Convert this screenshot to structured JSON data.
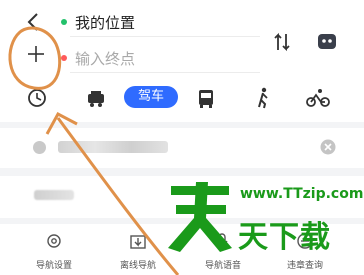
{
  "route": {
    "origin_label": "我的位置",
    "destination_placeholder": "输入终点"
  },
  "colors": {
    "start_dot": "#23c16b",
    "end_dot": "#ff5a5a",
    "accent": "#2f6bff",
    "annotation": "#e0914a",
    "watermark": "#1a9a1a"
  },
  "modes": {
    "recent_icon": "clock-icon",
    "taxi_icon": "taxi-icon",
    "drive_label": "驾车",
    "bus_icon": "bus-icon",
    "walk_icon": "walk-icon",
    "bike_icon": "bike-icon"
  },
  "bottom_bar": [
    {
      "label": "导航设置",
      "icon": "settings-icon"
    },
    {
      "label": "离线导航",
      "icon": "offline-download-icon"
    },
    {
      "label": "导航语音",
      "icon": "microphone-icon"
    },
    {
      "label": "违章查询",
      "icon": "violation-icon"
    }
  ],
  "watermark": {
    "site": "www.TTzip.com",
    "chars": "天下载"
  }
}
